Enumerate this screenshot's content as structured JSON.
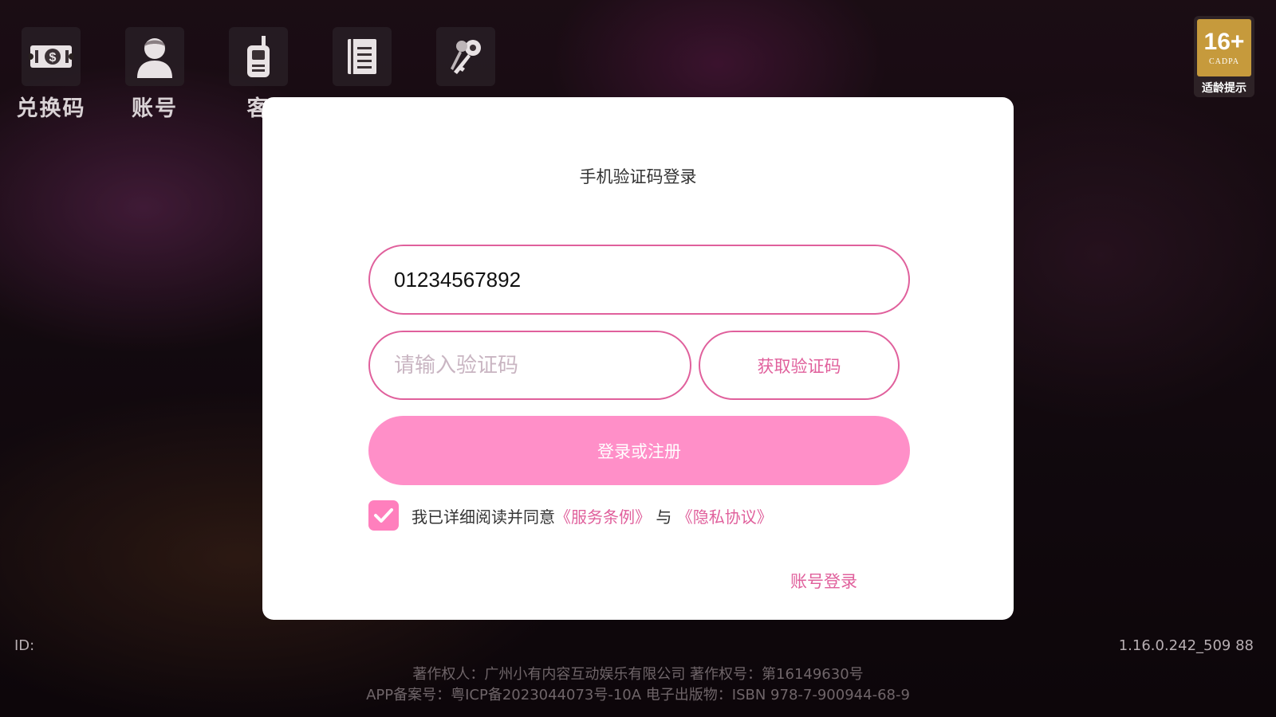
{
  "nav": {
    "items": [
      {
        "label": "兑换码",
        "icon": "redeem-ticket-icon"
      },
      {
        "label": "账号",
        "icon": "user-avatar-icon"
      },
      {
        "label": "客",
        "icon": "walkie-talkie-icon"
      },
      {
        "label": "",
        "icon": "notebook-icon"
      },
      {
        "label": "",
        "icon": "keys-icon"
      }
    ]
  },
  "age_badge": {
    "number": "16+",
    "org": "CADPA",
    "text": "适龄提示"
  },
  "modal": {
    "title": "手机验证码登录",
    "phone_value": "01234567892",
    "code_placeholder": "请输入验证码",
    "get_code_label": "获取验证码",
    "login_label": "登录或注册",
    "agree_prefix": "我已详细阅读并同意",
    "terms_link": "《服务条例》",
    "and_text": "与",
    "privacy_link": "《隐私协议》",
    "account_login_label": "账号登录",
    "agreement_checked": true
  },
  "status": {
    "id_label": "ID:",
    "version": "1.16.0.242_509 88"
  },
  "footer": {
    "line1": "著作权人：广州小有内容互动娱乐有限公司    著作权号：第16149630号",
    "line2": "APP备案号：粤ICP备2023044073号-10A 电子出版物：ISBN 978-7-900944-68-9"
  },
  "colors": {
    "accent": "#e0609c",
    "button": "#ff8fc8",
    "checkbox": "#ff7fbd"
  }
}
